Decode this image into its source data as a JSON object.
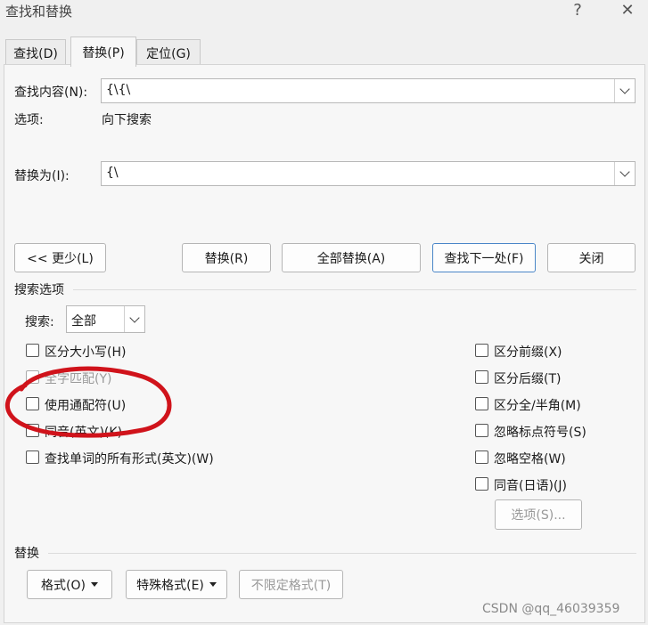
{
  "window": {
    "title": "查找和替换",
    "help_label": "?",
    "close_label": "✕"
  },
  "tabs": [
    {
      "label": "查找(D)"
    },
    {
      "label": "替换(P)"
    },
    {
      "label": "定位(G)"
    }
  ],
  "find": {
    "label": "查找内容(N):",
    "value": "{\\{\\",
    "options_label": "选项:",
    "options_value": "向下搜索"
  },
  "replace": {
    "label": "替换为(I):",
    "value": "{\\"
  },
  "buttons": {
    "less": "<< 更少(L)",
    "replace": "替换(R)",
    "replace_all": "全部替换(A)",
    "find_next": "查找下一处(F)",
    "close": "关闭"
  },
  "search_options": {
    "group_label": "搜索选项",
    "search_label": "搜索:",
    "search_value": "全部",
    "left_checks": [
      {
        "label": "区分大小写(H)",
        "enabled": true
      },
      {
        "label": "全字匹配(Y)",
        "enabled": false
      },
      {
        "label": "使用通配符(U)",
        "enabled": true
      },
      {
        "label": "同音(英文)(K)",
        "enabled": true
      },
      {
        "label": "查找单词的所有形式(英文)(W)",
        "enabled": true
      }
    ],
    "right_checks": [
      {
        "label": "区分前缀(X)"
      },
      {
        "label": "区分后缀(T)"
      },
      {
        "label": "区分全/半角(M)"
      },
      {
        "label": "忽略标点符号(S)"
      },
      {
        "label": "忽略空格(W)"
      },
      {
        "label": "同音(日语)(J)"
      }
    ],
    "options_button": "选项(S)..."
  },
  "replace_group": {
    "label": "替换",
    "format": "格式(O)",
    "special": "特殊格式(E)",
    "no_format": "不限定格式(T)"
  },
  "watermark": "CSDN @qq_46039359",
  "colors": {
    "annotation": "#d0131b",
    "focus_border": "#4a86c8"
  }
}
